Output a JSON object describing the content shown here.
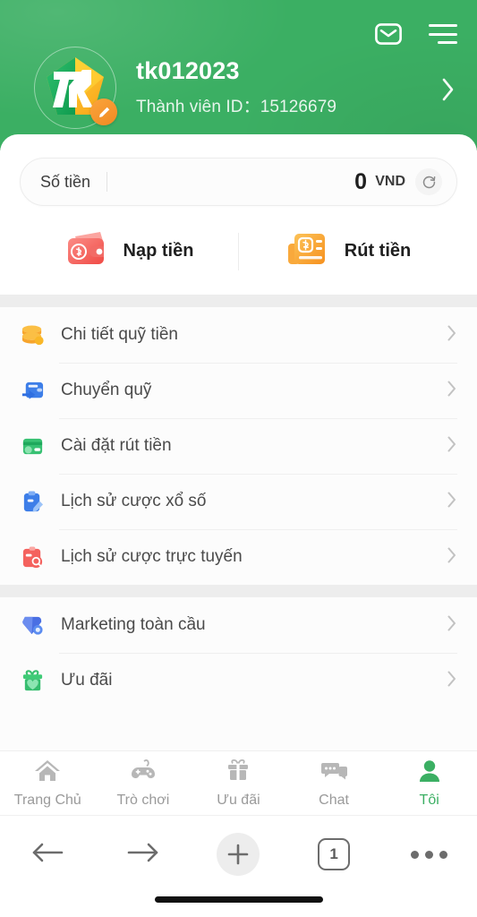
{
  "header": {
    "mail_icon": "mail-icon",
    "menu_icon": "hamburger-menu-icon",
    "username": "tk012023",
    "member_id_label": "Thành viên ID：",
    "member_id_value": "15126679",
    "avatar_logo_text": "7K",
    "edit_badge_icon": "pencil-icon",
    "chevron_icon": "chevron-right-icon",
    "bg_color": "#3BAF63"
  },
  "balance": {
    "label": "Số tiền",
    "amount": "0",
    "currency": "VND",
    "refresh_icon": "refresh-icon"
  },
  "actions": [
    {
      "label": "Nạp tiền",
      "icon": "wallet-deposit-icon",
      "color": "#F4625E"
    },
    {
      "label": "Rút tiền",
      "icon": "withdraw-document-icon",
      "color": "#F7A330"
    }
  ],
  "menu_sections": [
    {
      "items": [
        {
          "label": "Chi tiết quỹ tiền",
          "icon": "coins-stack-icon",
          "color": "#F5A623"
        },
        {
          "label": "Chuyển quỹ",
          "icon": "wallet-transfer-icon",
          "color": "#3D7EE8"
        },
        {
          "label": "Cài đặt rút tiền",
          "icon": "card-settings-icon",
          "color": "#35BD6E"
        },
        {
          "label": "Lịch sử cược xổ số",
          "icon": "clipboard-edit-icon",
          "color": "#3D7EE8"
        },
        {
          "label": "Lịch sử cược trực tuyến",
          "icon": "clipboard-search-icon",
          "color": "#F4625E"
        }
      ]
    },
    {
      "items": [
        {
          "label": "Marketing toàn cầu",
          "icon": "diamond-icon",
          "color": "#4A6FE3"
        },
        {
          "label": "Ưu đãi",
          "icon": "gift-heart-icon",
          "color": "#35BD6E"
        }
      ]
    }
  ],
  "tabbar": {
    "active_color": "#3BAF63",
    "items": [
      {
        "label": "Trang Chủ",
        "icon": "home-icon",
        "active": false
      },
      {
        "label": "Trò chơi",
        "icon": "gamepad-icon",
        "active": false
      },
      {
        "label": "Ưu đãi",
        "icon": "gift-icon",
        "active": false
      },
      {
        "label": "Chat",
        "icon": "chat-bubbles-icon",
        "active": false
      },
      {
        "label": "Tôi",
        "icon": "person-icon",
        "active": true
      }
    ]
  },
  "browser_toolbar": {
    "back_icon": "arrow-left-icon",
    "forward_icon": "arrow-right-icon",
    "new_tab_icon": "plus-icon",
    "tab_count": "1",
    "more_icon": "more-dots-icon"
  }
}
